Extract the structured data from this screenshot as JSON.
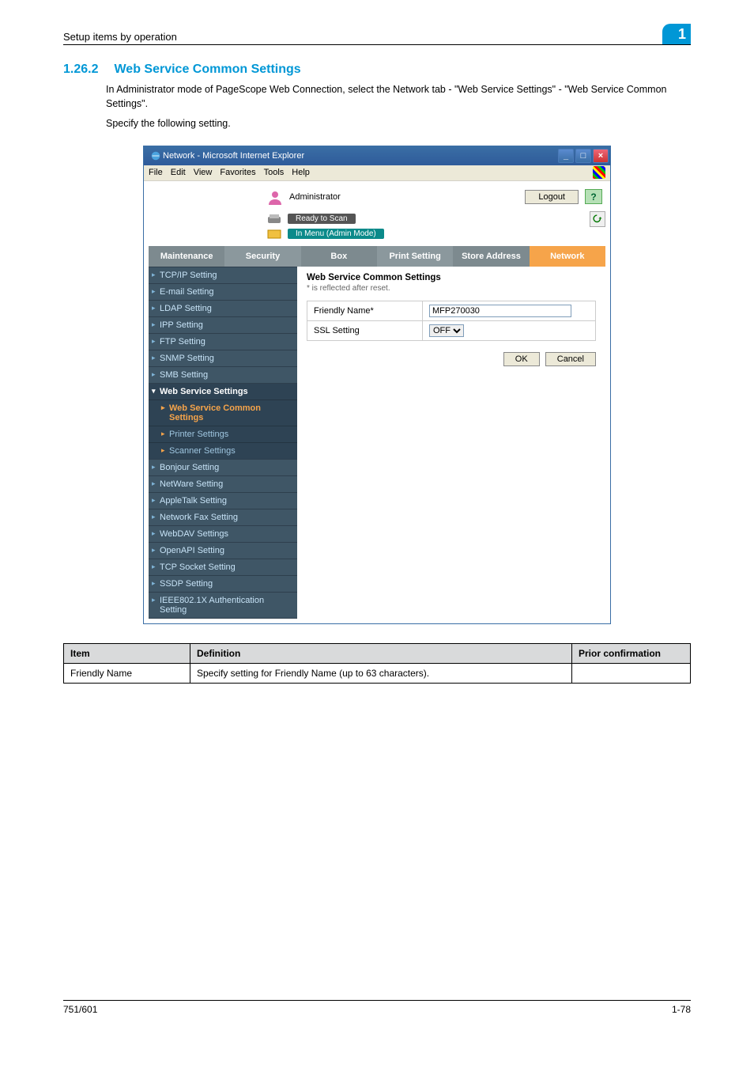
{
  "header": {
    "breadcrumb": "Setup items by operation",
    "chapter": "1"
  },
  "section": {
    "number": "1.26.2",
    "title": "Web Service Common Settings",
    "para1": "In Administrator mode of PageScope Web Connection, select the Network tab - \"Web Service Settings\" - \"Web Service Common Settings\".",
    "para2": "Specify the following setting."
  },
  "window": {
    "title": "Network - Microsoft Internet Explorer",
    "menus": [
      "File",
      "Edit",
      "View",
      "Favorites",
      "Tools",
      "Help"
    ],
    "admin_label": "Administrator",
    "logout_label": "Logout",
    "status_ready": "Ready to Scan",
    "status_mode": "In Menu (Admin Mode)",
    "tabs": [
      "Maintenance",
      "Security",
      "Box",
      "Print Setting",
      "Store Address",
      "Network"
    ],
    "sidebar": {
      "items": [
        "TCP/IP Setting",
        "E-mail Setting",
        "LDAP Setting",
        "IPP Setting",
        "FTP Setting",
        "SNMP Setting",
        "SMB Setting",
        "Web Service Settings",
        "Bonjour Setting",
        "NetWare Setting",
        "AppleTalk Setting",
        "Network Fax Setting",
        "WebDAV Settings",
        "OpenAPI Setting",
        "TCP Socket Setting",
        "SSDP Setting",
        "IEEE802.1X Authentication Setting"
      ],
      "subs": [
        "Web Service Common Settings",
        "Printer Settings",
        "Scanner Settings"
      ]
    },
    "panel": {
      "title": "Web Service Common Settings",
      "note": "* is reflected after reset.",
      "row1_label": "Friendly Name*",
      "row1_value": "MFP270030",
      "row2_label": "SSL Setting",
      "row2_value": "OFF",
      "ok_label": "OK",
      "cancel_label": "Cancel"
    }
  },
  "def_table": {
    "h1": "Item",
    "h2": "Definition",
    "h3": "Prior confirmation",
    "r1c1": "Friendly Name",
    "r1c2": "Specify setting for Friendly Name (up to 63 characters).",
    "r1c3": ""
  },
  "footer": {
    "left": "751/601",
    "right": "1-78"
  }
}
